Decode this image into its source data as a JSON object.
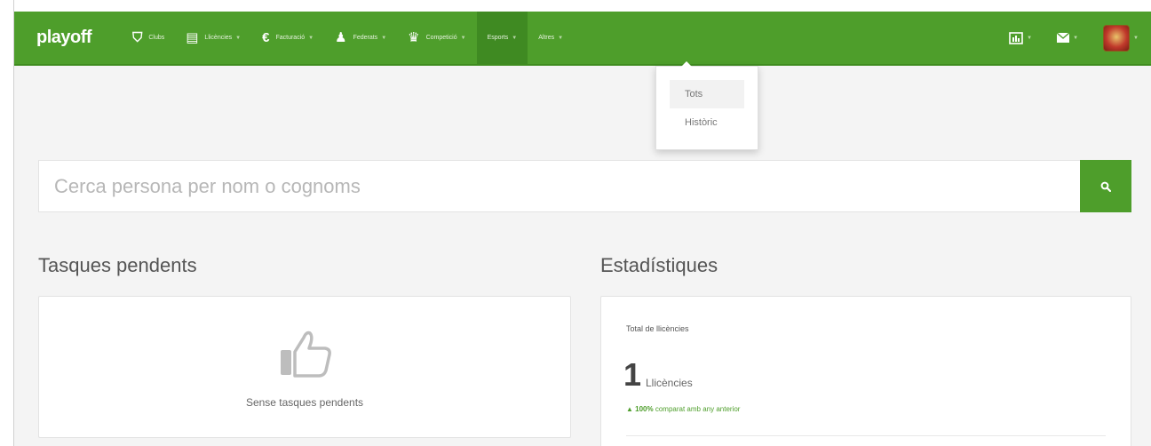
{
  "brand": "playoff",
  "nav": {
    "items": [
      {
        "label": "Clubs",
        "icon": "shield-icon"
      },
      {
        "label": "Llicències",
        "icon": "id-card-icon"
      },
      {
        "label": "Facturació",
        "icon": "euro-icon"
      },
      {
        "label": "Federats",
        "icon": "user-icon"
      },
      {
        "label": "Competició",
        "icon": "trophy-icon"
      },
      {
        "label": "Esports",
        "icon": ""
      },
      {
        "label": "Altres",
        "icon": ""
      }
    ],
    "active_index": 5,
    "right": [
      {
        "icon": "chart-icon"
      },
      {
        "icon": "envelope-icon"
      },
      {
        "icon": "avatar"
      }
    ]
  },
  "dropdown": {
    "items": [
      "Tots",
      "Històric"
    ]
  },
  "search": {
    "placeholder": "Cerca persona per nom o cognoms",
    "value": ""
  },
  "tasks": {
    "title": "Tasques pendents",
    "empty_icon": "thumbs-up-icon",
    "empty_text": "Sense tasques pendents"
  },
  "stats": {
    "title": "Estadístiques",
    "label": "Total de llicències",
    "value": "1",
    "unit": "Llicències",
    "trend_value": "100%",
    "trend_text": "comparat amb any anterior"
  },
  "colors": {
    "accent": "#4e9e2b",
    "accent_dark": "#3f8a22"
  }
}
